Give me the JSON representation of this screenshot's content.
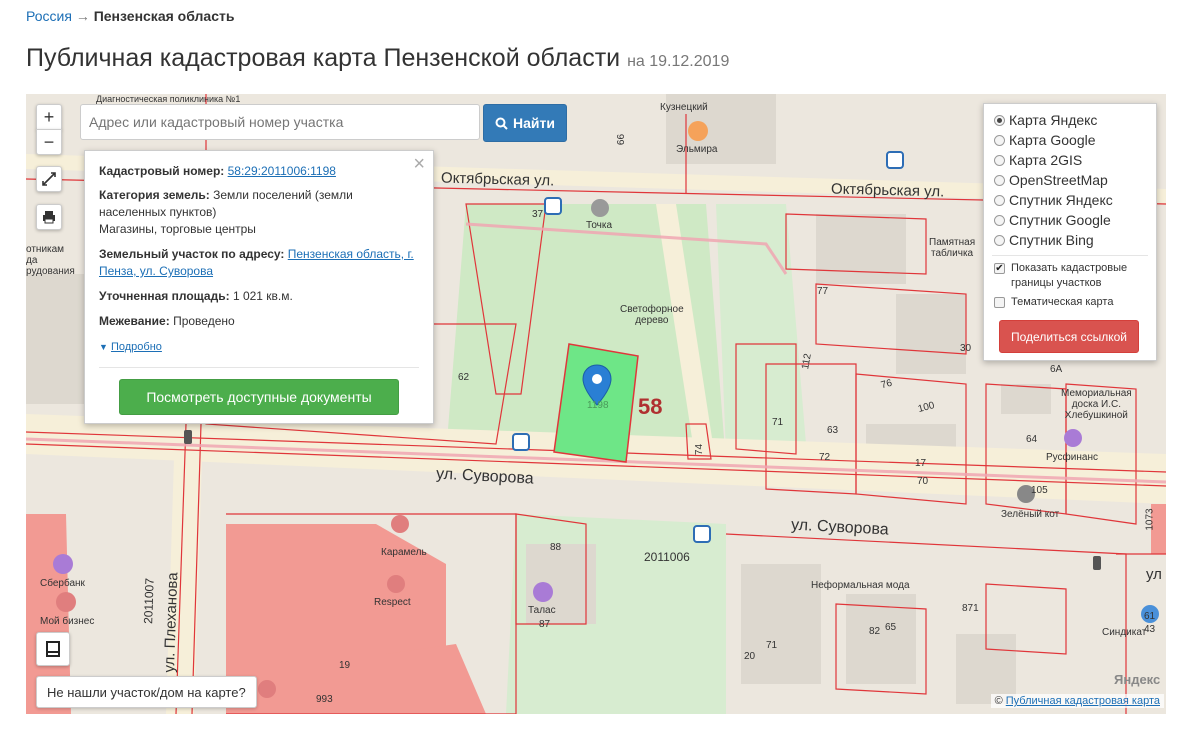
{
  "breadcrumb": {
    "country": "Россия",
    "arrow": "→",
    "region": "Пензенская область"
  },
  "page": {
    "title": "Публичная кадастровая карта Пензенской области",
    "date": "на 19.12.2019"
  },
  "search": {
    "placeholder": "Адрес или кадастровый номер участка",
    "button_label": "Найти"
  },
  "zoom": {
    "in": "+",
    "out": "−"
  },
  "info": {
    "cad_label": "Кадастровый номер:",
    "cad_value": "58:29:2011006:1198",
    "cat_label": "Категория земель:",
    "cat_value": "Земли поселений (земли населенных пунктов)",
    "use_value": "Магазины, торговые центры",
    "addr_label": "Земельный участок по адресу:",
    "addr_value": "Пензенская область, г. Пенза, ул. Суворова",
    "area_label": "Уточненная площадь:",
    "area_value": "1 021 кв.м.",
    "mezh_label": "Межевание:",
    "mezh_value": "Проведено",
    "more": "Подробно",
    "docs_button": "Посмотреть доступные документы"
  },
  "layers": {
    "options": [
      "Карта Яндекс",
      "Карта Google",
      "Карта 2GIS",
      "OpenStreetMap",
      "Спутник Яндекс",
      "Спутник Google",
      "Спутник Bing"
    ],
    "selected": "Карта Яндекс",
    "show_borders": "Показать кадастровые границы участков",
    "show_borders_checked": true,
    "thematic": "Тематическая карта",
    "thematic_checked": false,
    "share_button": "Поделиться ссылкой"
  },
  "map_labels": {
    "street_okt_1": "Октябрьская ул.",
    "street_okt_2": "Октябрьская ул.",
    "street_suv_1": "ул. Суворова",
    "street_suv_2": "ул. Суворова",
    "street_plekh": "ул. Плеханова",
    "kuznetsky": "Кузнецкий",
    "elmira": "Эльмира",
    "tochka": "Точка",
    "svetofor": "Светофорное\nдерево",
    "pamyatnaya": "Памятная\nтабличка",
    "memorial": "Мемориальная\nдоска И.С.\nХлебушкиной",
    "rusfinance": "Русфинанс",
    "zeleny_kot": "Зелёный кот",
    "neformal": "Неформальная мода",
    "karamel": "Карамель",
    "respect": "Respect",
    "talas": "Талас",
    "sberbank": "Сбербанк",
    "moy_biznes": "Мой бизнес",
    "sindikat": "Синдикат",
    "plot_number": "58",
    "plot_id": "1198",
    "block_code_1": "2011006",
    "block_code_2": "2011007",
    "diag_text": "Диагностическая поликлиника №1",
    "otnikam": "отникам\nда\nрудования",
    "n62": "62",
    "n37": "37",
    "n66": "66",
    "n77": "77",
    "n30": "30",
    "n6a": "6А",
    "n71": "71",
    "n63": "63",
    "n72": "72",
    "n17": "17",
    "n70": "70",
    "n64": "64",
    "n74": "74",
    "n100": "100",
    "n105": "105",
    "n88": "88",
    "n87": "87",
    "n65": "65",
    "n82": "82",
    "n20": "20",
    "n871": "871",
    "n1073": "1073",
    "n993": "993",
    "n19": "19",
    "n112": "112",
    "n76": "76",
    "n61": "61",
    "n43": "43",
    "yandex": "Яндекс",
    "ul_right": "ул"
  },
  "not_found": "Не нашли участок/дом на карте?",
  "attribution": {
    "prefix": "©",
    "link": "Публичная кадастровая карта"
  },
  "colors": {
    "plot": "#6ee687",
    "parcel_border": "#e0363a",
    "road": "#f6efd9",
    "park": "#cfe9c5",
    "pink_building": "#f29a93",
    "button_blue": "#337ab7",
    "button_green": "#4cae4c",
    "button_red": "#d9534f"
  }
}
